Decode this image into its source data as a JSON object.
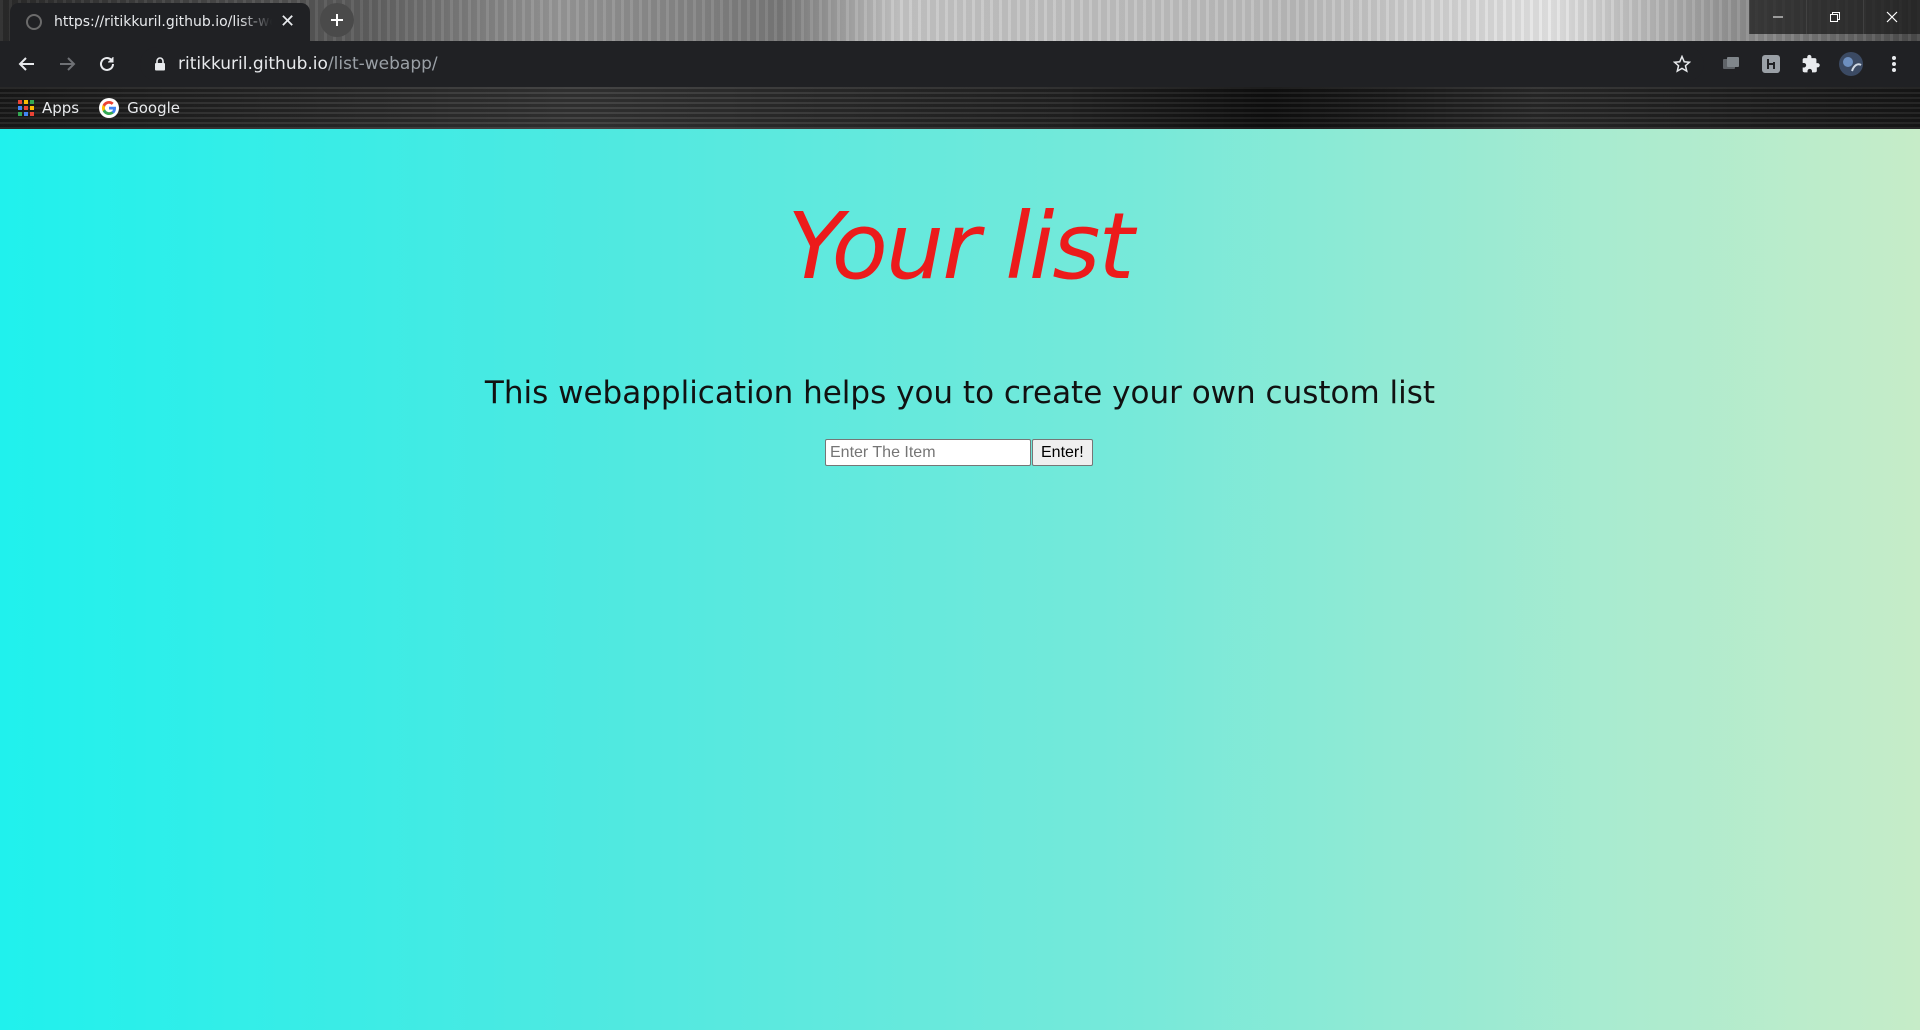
{
  "browser": {
    "tab": {
      "title": "https://ritikkuril.github.io/list-webapp/"
    },
    "address": {
      "host": "ritikkuril.github.io",
      "path": "/list-webapp/"
    },
    "bookmarks": [
      {
        "label": "Apps",
        "icon": "apps-grid-icon"
      },
      {
        "label": "Google",
        "icon": "google-icon"
      }
    ]
  },
  "page": {
    "heading": "Your list",
    "subtitle": "This webapplication helps you to create your own custom list",
    "input": {
      "placeholder": "Enter The Item",
      "value": ""
    },
    "button": "Enter!"
  },
  "colors": {
    "heading": "#ec1b1b",
    "gradient_start": "#20f1ed",
    "gradient_end": "#c6ecc8"
  }
}
